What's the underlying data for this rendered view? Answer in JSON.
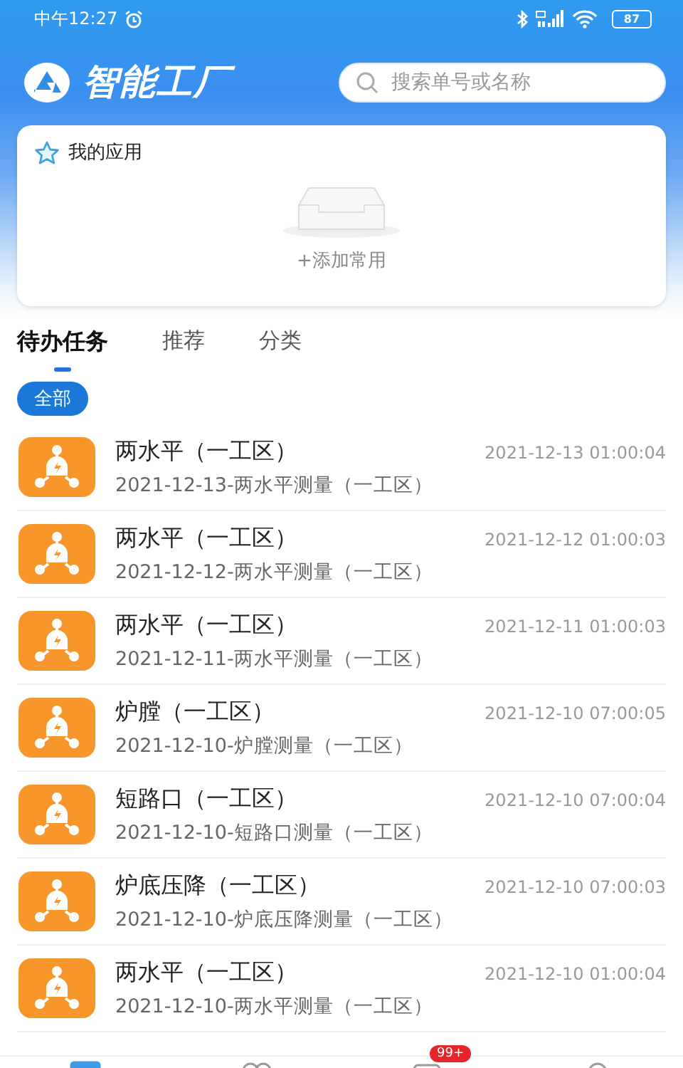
{
  "status_bar": {
    "time": "中午12:27",
    "battery": "87"
  },
  "header": {
    "title": "智能工厂",
    "search": {
      "placeholder": "搜索单号或名称"
    }
  },
  "my_apps": {
    "title": "我的应用",
    "empty_action": "+添加常用"
  },
  "tabs": [
    {
      "label": "待办任务",
      "selected": true
    },
    {
      "label": "推荐",
      "selected": false
    },
    {
      "label": "分类",
      "selected": false
    }
  ],
  "filters": [
    {
      "label": "全部",
      "selected": true
    }
  ],
  "tasks": [
    {
      "title": "两水平（一工区）",
      "subtitle": "2021-12-13-两水平测量（一工区）",
      "time": "2021-12-13 01:00:04"
    },
    {
      "title": "两水平（一工区）",
      "subtitle": "2021-12-12-两水平测量（一工区）",
      "time": "2021-12-12 01:00:03"
    },
    {
      "title": "两水平（一工区）",
      "subtitle": "2021-12-11-两水平测量（一工区）",
      "time": "2021-12-11 01:00:03"
    },
    {
      "title": "炉膛（一工区）",
      "subtitle": "2021-12-10-炉膛测量（一工区）",
      "time": "2021-12-10 07:00:05"
    },
    {
      "title": "短路口（一工区）",
      "subtitle": "2021-12-10-短路口测量（一工区）",
      "time": "2021-12-10 07:00:04"
    },
    {
      "title": "炉底压降（一工区）",
      "subtitle": "2021-12-10-炉底压降测量（一工区）",
      "time": "2021-12-10 07:00:03"
    },
    {
      "title": "两水平（一工区）",
      "subtitle": "2021-12-10-两水平测量（一工区）",
      "time": "2021-12-10 01:00:04"
    }
  ],
  "bottom_nav": [
    {
      "selected": true
    },
    {
      "selected": false
    },
    {
      "selected": false,
      "badge": "99+"
    },
    {
      "selected": false
    }
  ]
}
